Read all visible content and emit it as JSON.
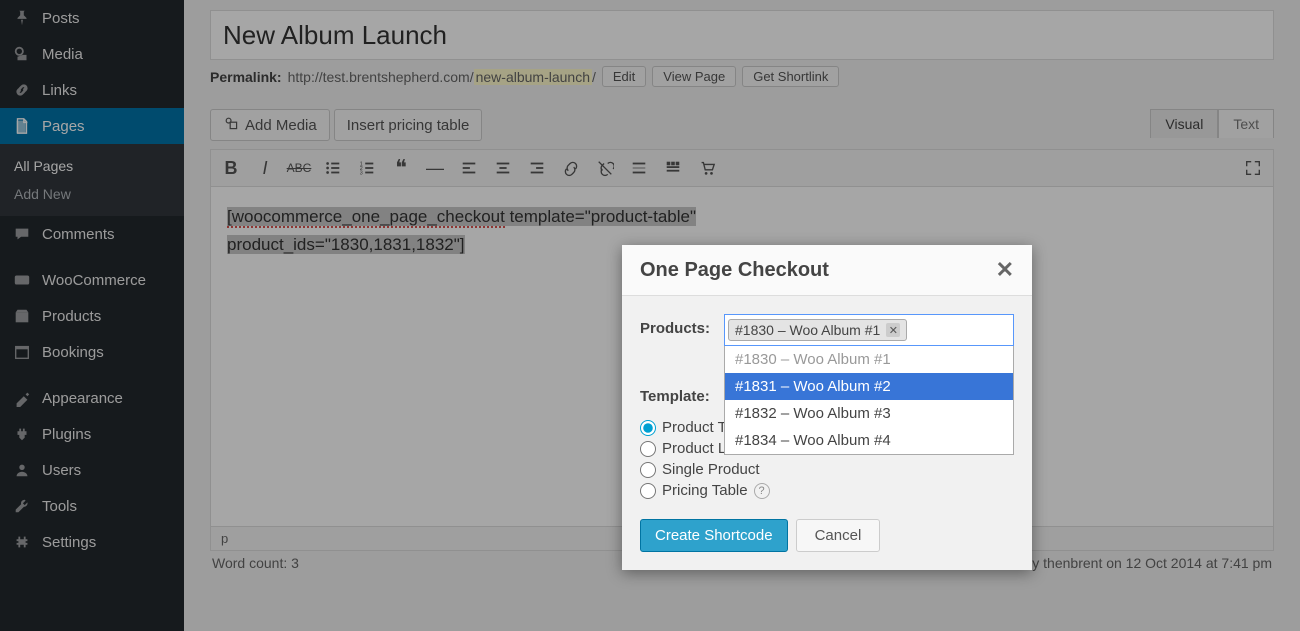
{
  "sidebar": {
    "items": [
      {
        "icon": "pin",
        "label": "Posts"
      },
      {
        "icon": "media",
        "label": "Media"
      },
      {
        "icon": "link",
        "label": "Links"
      },
      {
        "icon": "page",
        "label": "Pages",
        "current": true
      },
      {
        "icon": "comment",
        "label": "Comments"
      },
      {
        "icon": "woo",
        "label": "WooCommerce"
      },
      {
        "icon": "product",
        "label": "Products"
      },
      {
        "icon": "calendar",
        "label": "Bookings"
      },
      {
        "icon": "appearance",
        "label": "Appearance"
      },
      {
        "icon": "plugin",
        "label": "Plugins"
      },
      {
        "icon": "user",
        "label": "Users"
      },
      {
        "icon": "tool",
        "label": "Tools"
      },
      {
        "icon": "settings",
        "label": "Settings"
      }
    ],
    "submenu": [
      {
        "label": "All Pages",
        "current": true
      },
      {
        "label": "Add New"
      }
    ]
  },
  "editor": {
    "title": "New Album Launch",
    "permalink_label": "Permalink:",
    "permalink_base": "http://test.brentshepherd.com/",
    "permalink_slug": "new-album-launch",
    "permalink_trail": "/",
    "edit_btn": "Edit",
    "view_page_btn": "View Page",
    "get_shortlink_btn": "Get Shortlink",
    "add_media_btn": "Add Media",
    "insert_pricing_btn": "Insert pricing table",
    "visual_tab": "Visual",
    "text_tab": "Text",
    "content_line1_a": "[woocommerce_one_page_checkout",
    "content_line1_b": " template=\"product-table\"",
    "content_line2": "product_ids=\"1830,1831,1832\"]",
    "status_path": "p",
    "word_count_label": "Word count: 3",
    "last_edited": "Last edited by thenbrent on 12 Oct 2014 at 7:41 pm"
  },
  "modal": {
    "title": "One Page Checkout",
    "products_label": "Products:",
    "template_label": "Template:",
    "selected_tag": "#1830 – Woo Album #1",
    "dropdown": [
      {
        "label": "#1830 – Woo Album #1",
        "disabled": true
      },
      {
        "label": "#1831 – Woo Album #2",
        "highlight": true
      },
      {
        "label": "#1832 – Woo Album #3"
      },
      {
        "label": "#1834 – Woo Album #4"
      }
    ],
    "templates": [
      {
        "label": "Product Table",
        "checked": true
      },
      {
        "label": "Product List"
      },
      {
        "label": "Single Product"
      },
      {
        "label": "Pricing Table",
        "help": true
      }
    ],
    "create_btn": "Create Shortcode",
    "cancel_btn": "Cancel"
  }
}
